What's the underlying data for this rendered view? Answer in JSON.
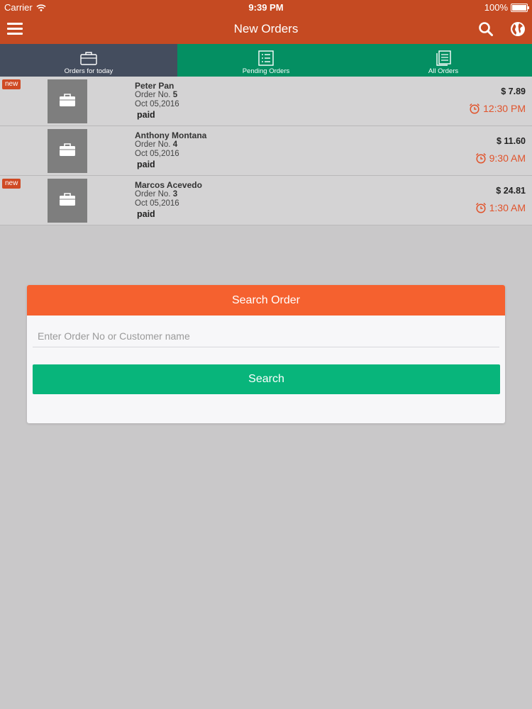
{
  "status_bar": {
    "carrier": "Carrier",
    "time": "9:39 PM",
    "battery": "100%"
  },
  "nav": {
    "title": "New Orders",
    "menu_icon": "hamburger-menu-icon",
    "search_icon": "search-icon",
    "globe_icon": "globe-icon"
  },
  "tabs": [
    {
      "label": "Orders for today",
      "icon": "briefcase-icon",
      "active": true
    },
    {
      "label": "Pending Orders",
      "icon": "checklist-icon",
      "active": false
    },
    {
      "label": "All Orders",
      "icon": "documents-icon",
      "active": false
    }
  ],
  "orders": [
    {
      "badge": "new",
      "customer": "Peter Pan",
      "order_prefix": "Order No. ",
      "order_no": "5",
      "date": "Oct 05,2016",
      "status": "paid",
      "price": "$ 7.89",
      "time": "12:30 PM"
    },
    {
      "badge": "",
      "customer": "Anthony Montana",
      "order_prefix": "Order No. ",
      "order_no": "4",
      "date": "Oct 05,2016",
      "status": "paid",
      "price": "$ 11.60",
      "time": "9:30 AM"
    },
    {
      "badge": "new",
      "customer": "Marcos Acevedo",
      "order_prefix": "Order No. ",
      "order_no": "3",
      "date": "Oct 05,2016",
      "status": "paid",
      "price": "$ 24.81",
      "time": "1:30 AM"
    }
  ],
  "search_card": {
    "title": "Search Order",
    "placeholder": "Enter Order No or Customer name",
    "value": "",
    "button_label": "Search"
  },
  "colors": {
    "header": "#c54a22",
    "tab_active": "#444d5e",
    "tab_inactive": "#048f62",
    "card_header": "#f5612f",
    "search_button": "#08b57b",
    "time_accent": "#e1532b",
    "new_badge": "#cf4a24"
  }
}
